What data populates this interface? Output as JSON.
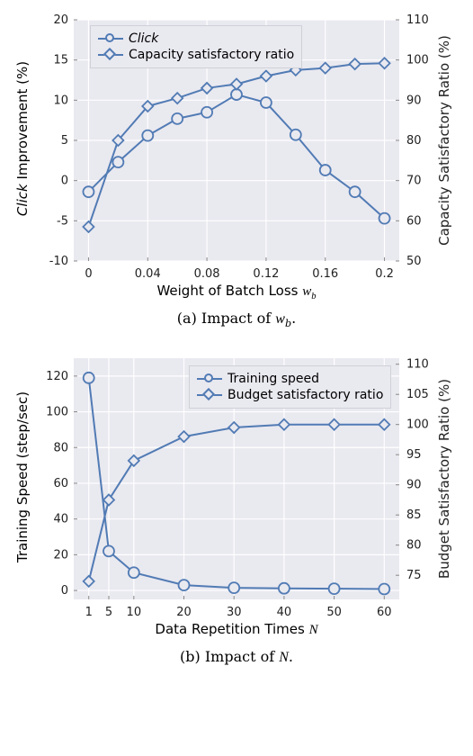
{
  "chart_data": [
    {
      "type": "line",
      "id": "a",
      "xlabel_html": "Weight of Batch Loss <span style='font-style:italic;font-family:Times New Roman,serif'>w<sub style='font-size:0.7em'>b</sub></span>",
      "y1label_html": "<span style='font-style:italic'>Click</span> Improvement (%)",
      "y2label": "Capacity Satisfactory Ratio (%)",
      "x": [
        0,
        0.02,
        0.04,
        0.06,
        0.08,
        0.1,
        0.12,
        0.14,
        0.16,
        0.18,
        0.2
      ],
      "xticks": [
        0,
        0.04,
        0.08,
        0.12,
        0.16,
        0.2
      ],
      "xlim": [
        -0.01,
        0.21
      ],
      "y1lim": [
        -10,
        20
      ],
      "y2lim": [
        50,
        110
      ],
      "y1ticks": [
        -10,
        -5,
        0,
        5,
        10,
        15,
        20
      ],
      "y2ticks": [
        50,
        60,
        70,
        80,
        90,
        100,
        110
      ],
      "series": [
        {
          "name": "Click",
          "marker": "circle",
          "axis": "y1",
          "values": [
            -1.4,
            2.3,
            5.6,
            7.7,
            8.5,
            10.7,
            9.7,
            5.7,
            1.3,
            -1.4,
            -4.7
          ]
        },
        {
          "name": "Capacity satisfactory ratio",
          "marker": "diamond",
          "axis": "y2",
          "values": [
            58.5,
            80,
            88.5,
            90.5,
            93,
            94,
            96,
            97.5,
            98,
            99,
            99.2
          ]
        }
      ],
      "legend": [
        {
          "label_html": "<span class='it'>Click</span>",
          "marker": "circle"
        },
        {
          "label": "Capacity satisfactory ratio",
          "marker": "diamond"
        }
      ],
      "caption_html": "(a) Impact of <span class='math'>w</span><span class='sub'>b</span>."
    },
    {
      "type": "line",
      "id": "b",
      "xlabel_html": "Data Repetition Times <span style='font-style:italic;font-family:Times New Roman,serif'>N</span>",
      "y1label": "Training Speed (step/sec)",
      "y2label": "Budget Satisfactory Ratio (%)",
      "x": [
        1,
        5,
        10,
        20,
        30,
        40,
        50,
        60
      ],
      "xticks": [
        1,
        5,
        10,
        20,
        30,
        40,
        50,
        60
      ],
      "xlim": [
        -2,
        63
      ],
      "y1lim": [
        -5,
        130
      ],
      "y2lim": [
        71,
        111
      ],
      "y1ticks": [
        0,
        20,
        40,
        60,
        80,
        100,
        120
      ],
      "y2ticks": [
        75,
        80,
        85,
        90,
        95,
        100,
        105,
        110
      ],
      "series": [
        {
          "name": "Training speed",
          "marker": "circle",
          "axis": "y1",
          "values": [
            119,
            22,
            10,
            3,
            1.5,
            1.2,
            1.0,
            0.8
          ]
        },
        {
          "name": "Budget satisfactory ratio",
          "marker": "diamond",
          "axis": "y2",
          "values": [
            74,
            87.5,
            94,
            98,
            99.5,
            100,
            100,
            100
          ]
        }
      ],
      "legend": [
        {
          "label": "Training speed",
          "marker": "circle"
        },
        {
          "label": "Budget satisfactory ratio",
          "marker": "diamond"
        }
      ],
      "caption_html": "(b) Impact of <span class='math'>N</span>."
    }
  ],
  "colors": {
    "line": "#517bb4",
    "grid": "#ffffff",
    "bg": "#e9e9f0"
  }
}
